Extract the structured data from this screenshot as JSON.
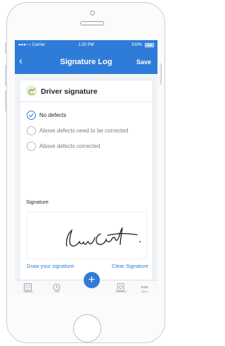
{
  "status_bar": {
    "carrier": "●●●○○ Carrier",
    "time": "1:20 PM",
    "battery": "100%"
  },
  "nav": {
    "back_icon": "‹",
    "title": "Signature Log",
    "save_label": "Save"
  },
  "section": {
    "title": "Driver signature"
  },
  "options": [
    {
      "label": "No defects",
      "checked": true
    },
    {
      "label": "Above defects need to be corrected",
      "checked": false
    },
    {
      "label": "Above defects corrected",
      "checked": false
    }
  ],
  "signature": {
    "label": "Signature",
    "draw_label": "Draw your signature",
    "clear_label": "Clear Signature",
    "handwritten_text": "Lara Croft"
  },
  "tabs": [
    {
      "label": "Logbook",
      "icon": "logbook-icon"
    },
    {
      "label": "HOS",
      "icon": "hos-icon"
    },
    {
      "label": "Inspection",
      "icon": "inspection-icon"
    },
    {
      "label": "Menu",
      "icon": "menu-icon"
    }
  ],
  "fab": {
    "label": "+"
  },
  "colors": {
    "accent": "#2f7cd8",
    "screen_bg": "#f1f3f6"
  }
}
